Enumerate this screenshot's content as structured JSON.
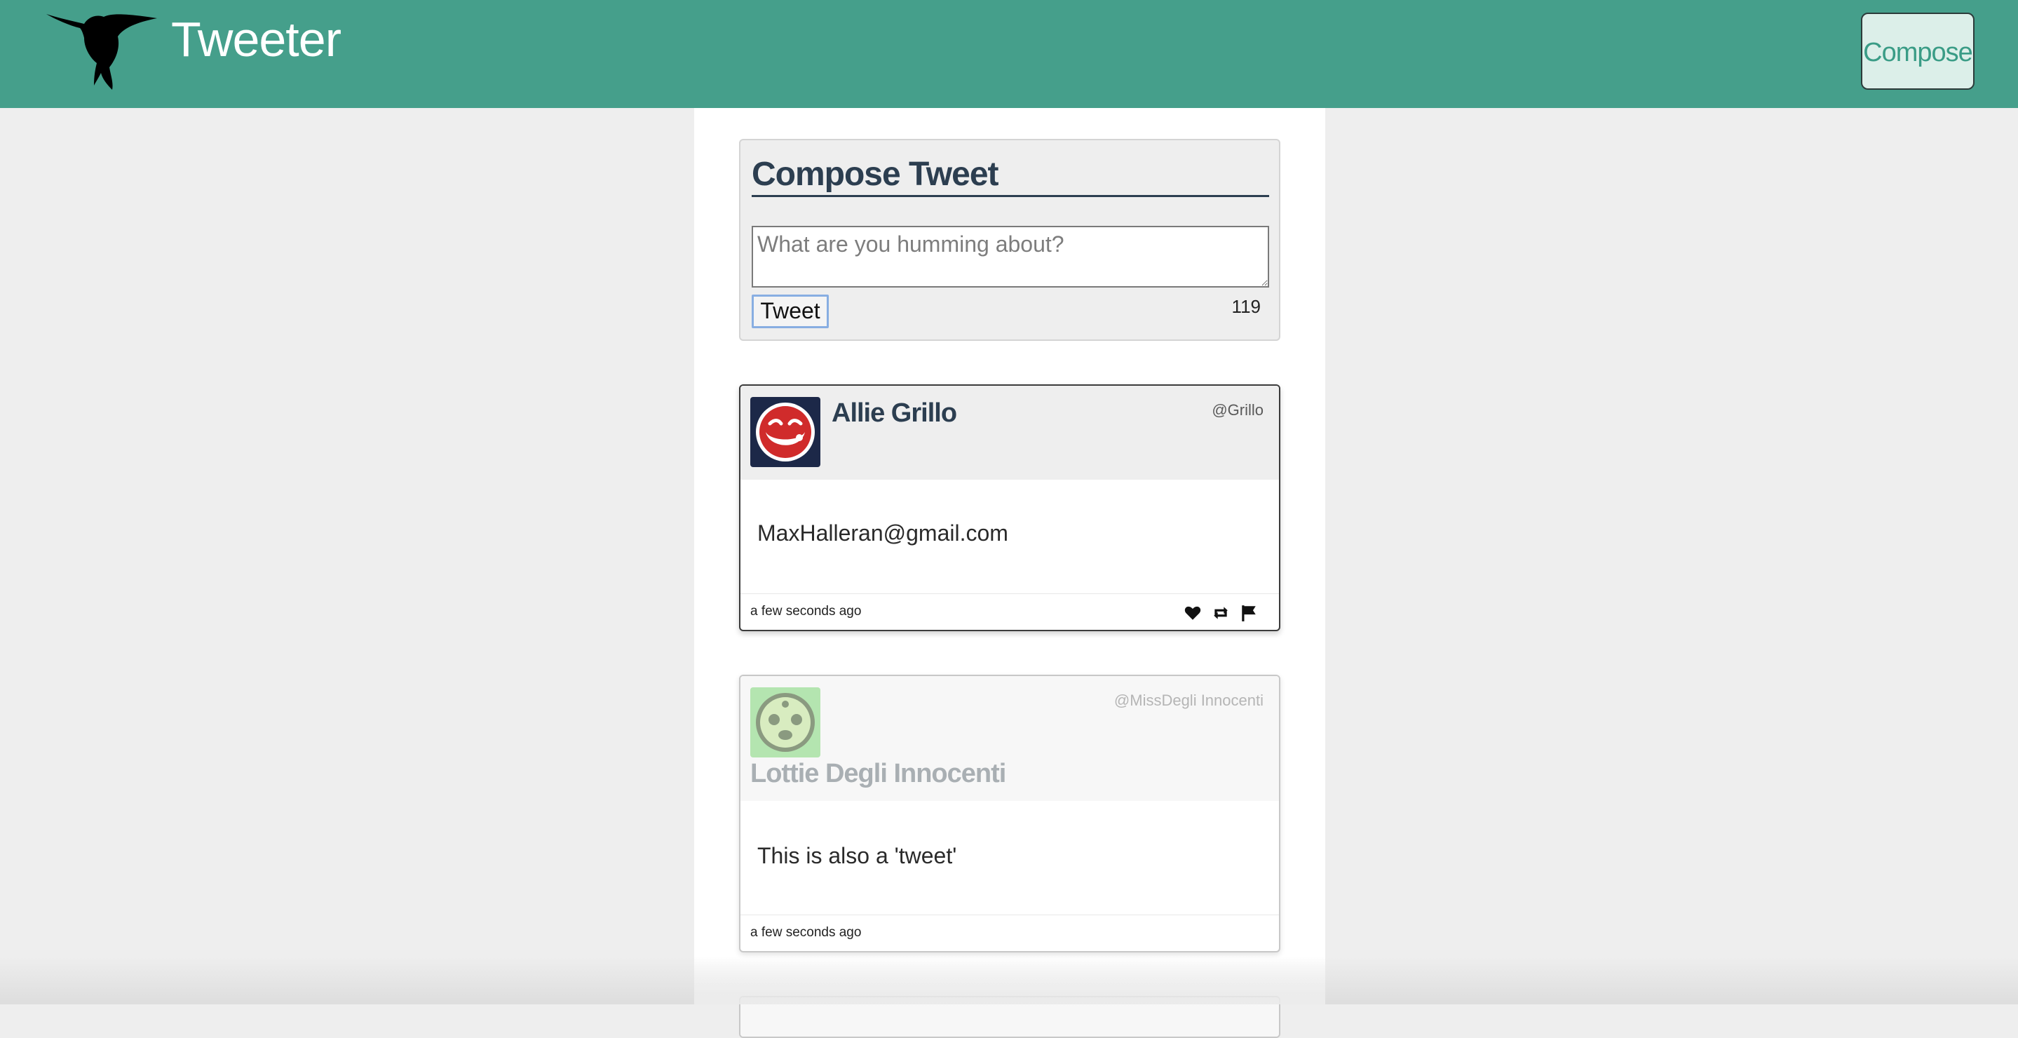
{
  "header": {
    "brand": "Tweeter",
    "compose_label": "Compose"
  },
  "compose": {
    "title": "Compose Tweet",
    "placeholder": "What are you humming about?",
    "tweet_button": "Tweet",
    "counter": "119"
  },
  "tweets": [
    {
      "author": "Allie Grillo",
      "handle": "@Grillo",
      "body": "MaxHalleran@gmail.com",
      "timestamp": "a few seconds ago"
    },
    {
      "author": "Lottie Degli Innocenti",
      "handle": "@MissDegli Innocenti",
      "body": "This is also a 'tweet'",
      "timestamp": "a few seconds ago"
    }
  ],
  "icons": {
    "logo": "hummingbird-logo",
    "like": "heart-icon",
    "retweet": "retweet-icon",
    "flag": "flag-icon"
  },
  "colors": {
    "nav": "#459f8b",
    "accent": "#3a9c86",
    "heading": "#2c3e50"
  }
}
